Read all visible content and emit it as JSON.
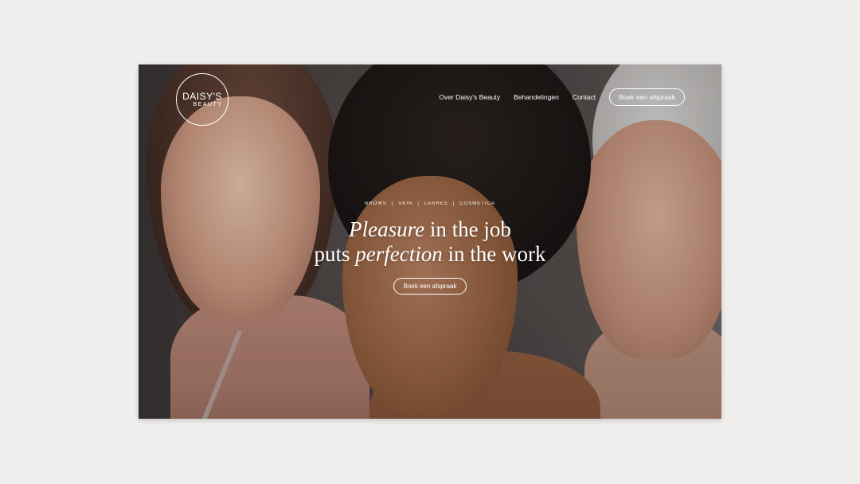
{
  "logo": {
    "line1": "DAISY'S",
    "line2": "BEAUTY"
  },
  "nav": {
    "items": [
      {
        "label": "Over Daisy's Beauty"
      },
      {
        "label": "Behandelingen"
      },
      {
        "label": "Contact"
      }
    ],
    "cta_label": "Boek een afspraak"
  },
  "hero": {
    "categories": [
      "BROWS",
      "|",
      "SKIN",
      "|",
      "LASHES",
      "|",
      "COSMETICA"
    ],
    "headline": {
      "line1_italic": "Pleasure",
      "line1_rest": " in the job",
      "line2_start": "puts ",
      "line2_italic": "perfection",
      "line2_rest": " in the work"
    },
    "cta_label": "Boek een afspraak"
  },
  "colors": {
    "page_background": "#efeeec",
    "text": "#ffffff"
  }
}
